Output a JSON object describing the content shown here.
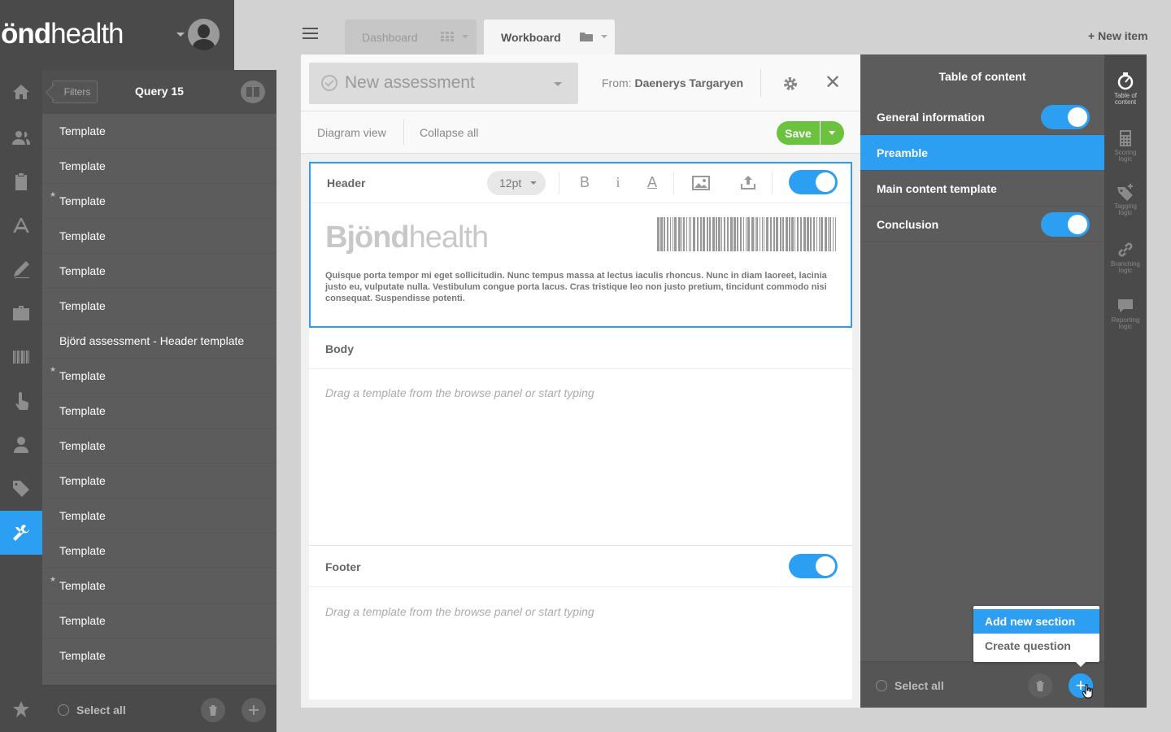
{
  "brand": {
    "logo_bold": "Bjönd",
    "logo_light": "health"
  },
  "rail": {
    "icons": [
      "home-icon",
      "users-icon",
      "clipboard-icon",
      "app-store-icon",
      "pen-icon",
      "briefcase-icon",
      "barcode-icon",
      "touch-icon",
      "person-icon",
      "tag-icon",
      "tools-icon",
      "star-icon"
    ],
    "active": "tools-icon",
    "accent": "#2d9ff2"
  },
  "left_panel": {
    "filters_label": "Filters",
    "query_title": "Query 15",
    "templates": [
      {
        "label": "Template",
        "starred": false
      },
      {
        "label": "Template",
        "starred": false
      },
      {
        "label": "Template",
        "starred": true
      },
      {
        "label": "Template",
        "starred": false
      },
      {
        "label": "Template",
        "starred": false
      },
      {
        "label": "Template",
        "starred": false
      },
      {
        "label": "Björd assessment - Header template",
        "starred": false
      },
      {
        "label": "Template",
        "starred": true
      },
      {
        "label": "Template",
        "starred": false
      },
      {
        "label": "Template",
        "starred": false
      },
      {
        "label": "Template",
        "starred": false
      },
      {
        "label": "Template",
        "starred": false
      },
      {
        "label": "Template",
        "starred": false
      },
      {
        "label": "Template",
        "starred": true
      },
      {
        "label": "Template",
        "starred": false
      },
      {
        "label": "Template",
        "starred": false
      }
    ],
    "select_all": "Select all"
  },
  "topbar": {
    "tabs": [
      {
        "label": "Dashboard",
        "active": false
      },
      {
        "label": "Workboard",
        "active": true
      }
    ],
    "new_item": "+ New item"
  },
  "editor": {
    "assessment_title": "New assessment",
    "from_label": "From:",
    "from_name": "Daenerys Targaryen",
    "diagram_view": "Diagram view",
    "collapse_all": "Collapse all",
    "save": "Save",
    "header": {
      "title": "Header",
      "font_size": "12pt",
      "bold": "B",
      "italic": "i",
      "color": "A",
      "logo_bold": "Bjönd",
      "logo_light": "health",
      "text": "Quisque porta tempor mi eget sollicitudin. Nunc tempus massa at lectus iaculis rhoncus. Nunc in diam laoreet, lacinia justo eu, vulputate nulla. Vestibulum congue porta lacus. Cras tristique leo non justo pretium, tincidunt commodo nisi consequat. Suspendisse potenti."
    },
    "body": {
      "title": "Body",
      "placeholder": "Drag a template from the browse panel or start typing"
    },
    "footer": {
      "title": "Footer",
      "placeholder": "Drag a template from the browse panel or start typing"
    }
  },
  "toc": {
    "title": "Table of content",
    "items": [
      {
        "label": "General information",
        "toggle": true,
        "active": false
      },
      {
        "label": "Preamble",
        "toggle": false,
        "active": true
      },
      {
        "label": "Main content template",
        "toggle": false,
        "active": false
      },
      {
        "label": "Conclusion",
        "toggle": true,
        "active": false
      }
    ],
    "select_all": "Select all",
    "popup": {
      "add_section": "Add new section",
      "create_question": "Create question"
    }
  },
  "right_rail": [
    {
      "icon": "stopwatch-icon",
      "label": "Table of content",
      "active": true
    },
    {
      "icon": "calculator-icon",
      "label": "Scoring logic",
      "active": false
    },
    {
      "icon": "tag-icon",
      "label": "Tagging logic",
      "active": false
    },
    {
      "icon": "link-icon",
      "label": "Branching logic",
      "active": false
    },
    {
      "icon": "speech-bubble-icon",
      "label": "Reporting logic",
      "active": false
    }
  ]
}
